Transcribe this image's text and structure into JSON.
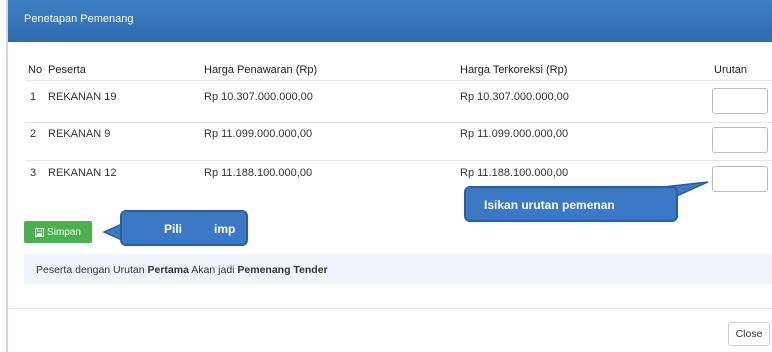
{
  "dialog": {
    "title": "Penetapan Pemenang"
  },
  "table": {
    "headers": [
      "No",
      "Peserta",
      "Harga Penawaran (Rp)",
      "Harga Terkoreksi (Rp)",
      "Urutan"
    ],
    "rows": [
      {
        "no": "1",
        "peserta": "REKANAN 19",
        "penawaran": "Rp 10.307.000.000,00",
        "terkoreksi": "Rp 10.307.000.000,00",
        "urutan": ""
      },
      {
        "no": "2",
        "peserta": "REKANAN 9",
        "penawaran": "Rp 11.099.000.000,00",
        "terkoreksi": "Rp 11.099.000.000,00",
        "urutan": ""
      },
      {
        "no": "3",
        "peserta": "REKANAN 12",
        "penawaran": "Rp 11.188.100.000,00",
        "terkoreksi": "Rp 11.188.100.000,00",
        "urutan": ""
      }
    ]
  },
  "actions": {
    "save_label": "Simpan",
    "close_label": "Close"
  },
  "info": {
    "part1": "Peserta dengan Urutan ",
    "bold1": "Pertama",
    "part2": " Akan jadi ",
    "bold2": "Pemenang Tender"
  },
  "callouts": {
    "save_hint_a": "Pili",
    "save_hint_b": "imp",
    "order_hint": "Isikan urutan pemenan"
  },
  "colors": {
    "header": "#3a7bc2",
    "save_button": "#4caf50",
    "callout": "#3b78c5"
  },
  "icons": {
    "save": "floppy-disk-icon"
  }
}
